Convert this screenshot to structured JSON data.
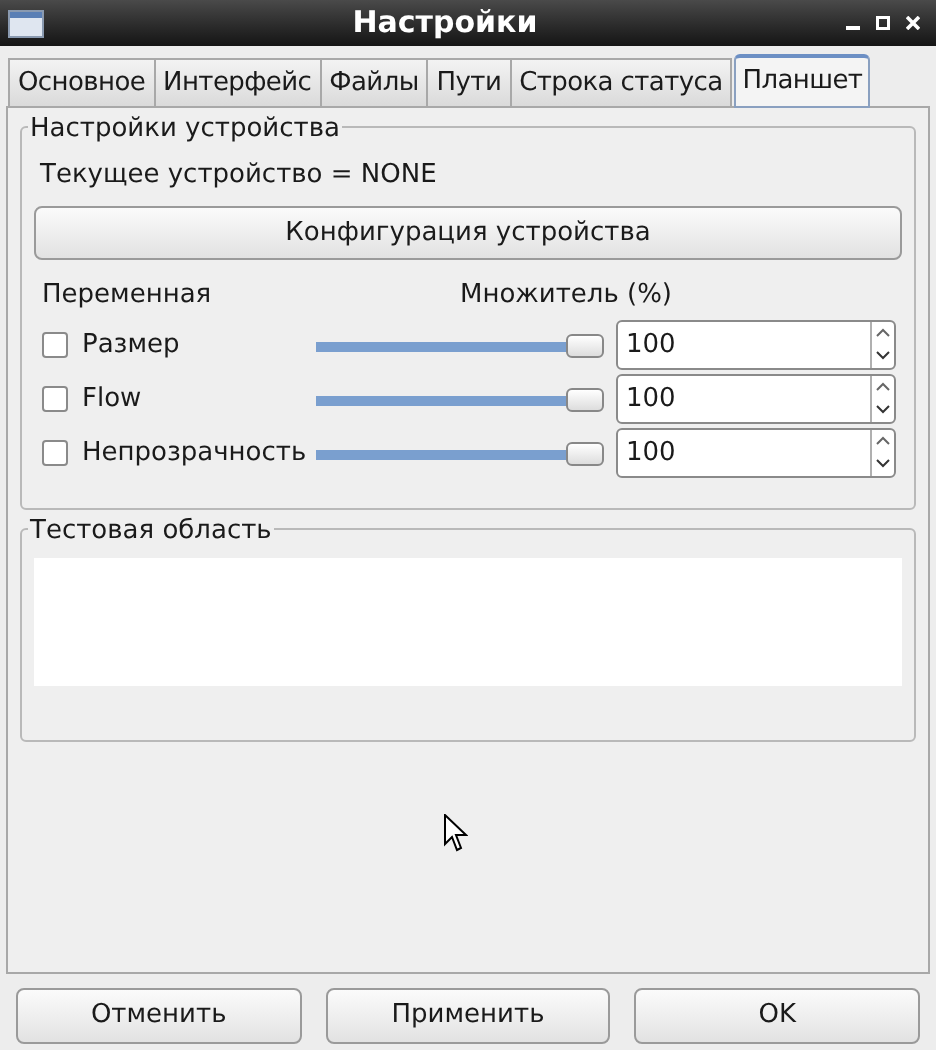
{
  "window": {
    "title": "Настройки"
  },
  "tabs": [
    {
      "label": "Основное",
      "selected": false
    },
    {
      "label": "Интерфейс",
      "selected": false
    },
    {
      "label": "Файлы",
      "selected": false
    },
    {
      "label": "Пути",
      "selected": false
    },
    {
      "label": "Строка статуса",
      "selected": false
    },
    {
      "label": "Планшет",
      "selected": true
    }
  ],
  "device_group": {
    "title": "Настройки устройства",
    "current_device": "Текущее устройство = NONE",
    "configure_button": "Конфигурация устройства",
    "column_headers": [
      "Переменная",
      "Множитель (%)"
    ],
    "variables": [
      {
        "label": "Размер",
        "checked": false,
        "level": 1,
        "value": "100"
      },
      {
        "label": "Flow",
        "checked": false,
        "level": 1,
        "value": "100"
      },
      {
        "label": "Непрозрачность",
        "checked": false,
        "level": 1,
        "value": "100"
      }
    ]
  },
  "test_group": {
    "title": "Тестовая область"
  },
  "buttons": [
    "Отменить",
    "Применить",
    "OK"
  ]
}
